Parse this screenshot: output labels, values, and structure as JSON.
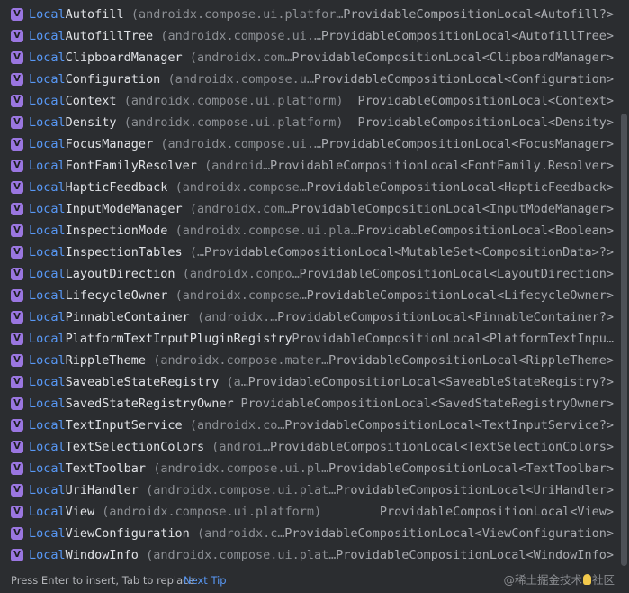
{
  "popup": {
    "items": [
      {
        "prefix": "Local",
        "rest": "Autofill",
        "pkg": "(androidx.compose.ui.platfor…",
        "type": "ProvidableCompositionLocal<Autofill?>"
      },
      {
        "prefix": "Local",
        "rest": "AutofillTree",
        "pkg": "(androidx.compose.ui.…",
        "type": "ProvidableCompositionLocal<AutofillTree>"
      },
      {
        "prefix": "Local",
        "rest": "ClipboardManager",
        "pkg": "(androidx.com…",
        "type": "ProvidableCompositionLocal<ClipboardManager>"
      },
      {
        "prefix": "Local",
        "rest": "Configuration",
        "pkg": "(androidx.compose.u…",
        "type": "ProvidableCompositionLocal<Configuration>"
      },
      {
        "prefix": "Local",
        "rest": "Context",
        "pkg": "(androidx.compose.ui.platform)",
        "type": "ProvidableCompositionLocal<Context>"
      },
      {
        "prefix": "Local",
        "rest": "Density",
        "pkg": "(androidx.compose.ui.platform)",
        "type": "ProvidableCompositionLocal<Density>"
      },
      {
        "prefix": "Local",
        "rest": "FocusManager",
        "pkg": "(androidx.compose.ui.…",
        "type": "ProvidableCompositionLocal<FocusManager>"
      },
      {
        "prefix": "Local",
        "rest": "FontFamilyResolver",
        "pkg": "(android…",
        "type": "ProvidableCompositionLocal<FontFamily.Resolver>"
      },
      {
        "prefix": "Local",
        "rest": "HapticFeedback",
        "pkg": "(androidx.compose…",
        "type": "ProvidableCompositionLocal<HapticFeedback>"
      },
      {
        "prefix": "Local",
        "rest": "InputModeManager",
        "pkg": "(androidx.com…",
        "type": "ProvidableCompositionLocal<InputModeManager>"
      },
      {
        "prefix": "Local",
        "rest": "InspectionMode",
        "pkg": "(androidx.compose.ui.pla…",
        "type": "ProvidableCompositionLocal<Boolean>"
      },
      {
        "prefix": "Local",
        "rest": "InspectionTables",
        "pkg": "(…",
        "type": "ProvidableCompositionLocal<MutableSet<CompositionData>?>"
      },
      {
        "prefix": "Local",
        "rest": "LayoutDirection",
        "pkg": "(androidx.compo…",
        "type": "ProvidableCompositionLocal<LayoutDirection>"
      },
      {
        "prefix": "Local",
        "rest": "LifecycleOwner",
        "pkg": "(androidx.compose…",
        "type": "ProvidableCompositionLocal<LifecycleOwner>"
      },
      {
        "prefix": "Local",
        "rest": "PinnableContainer",
        "pkg": "(androidx.…",
        "type": "ProvidableCompositionLocal<PinnableContainer?>"
      },
      {
        "prefix": "Local",
        "rest": "PlatformTextInputPluginRegistry",
        "pkg": "",
        "type": "ProvidableCompositionLocal<PlatformTextInpu…"
      },
      {
        "prefix": "Local",
        "rest": "RippleTheme",
        "pkg": "(androidx.compose.mater…",
        "type": "ProvidableCompositionLocal<RippleTheme>"
      },
      {
        "prefix": "Local",
        "rest": "SaveableStateRegistry",
        "pkg": "(a…",
        "type": "ProvidableCompositionLocal<SaveableStateRegistry?>"
      },
      {
        "prefix": "Local",
        "rest": "SavedStateRegistryOwner",
        "pkg": "",
        "type": "ProvidableCompositionLocal<SavedStateRegistryOwner>"
      },
      {
        "prefix": "Local",
        "rest": "TextInputService",
        "pkg": "(androidx.co…",
        "type": "ProvidableCompositionLocal<TextInputService?>"
      },
      {
        "prefix": "Local",
        "rest": "TextSelectionColors",
        "pkg": "(androi…",
        "type": "ProvidableCompositionLocal<TextSelectionColors>"
      },
      {
        "prefix": "Local",
        "rest": "TextToolbar",
        "pkg": "(androidx.compose.ui.pl…",
        "type": "ProvidableCompositionLocal<TextToolbar>"
      },
      {
        "prefix": "Local",
        "rest": "UriHandler",
        "pkg": "(androidx.compose.ui.plat…",
        "type": "ProvidableCompositionLocal<UriHandler>"
      },
      {
        "prefix": "Local",
        "rest": "View",
        "pkg": "(androidx.compose.ui.platform)",
        "type": "ProvidableCompositionLocal<View>"
      },
      {
        "prefix": "Local",
        "rest": "ViewConfiguration",
        "pkg": "(androidx.c…",
        "type": "ProvidableCompositionLocal<ViewConfiguration>"
      },
      {
        "prefix": "Local",
        "rest": "WindowInfo",
        "pkg": "(androidx.compose.ui.plat…",
        "type": "ProvidableCompositionLocal<WindowInfo>"
      }
    ],
    "item_icon": {
      "letter": "V",
      "name": "variable-icon",
      "color": "#9a76e0"
    },
    "colors": {
      "background": "#2b2d30",
      "match_highlight": "#5898f5",
      "name_text": "#dfe1e5",
      "package_text": "#8c8f94",
      "type_text": "#a9abb0"
    }
  },
  "footer": {
    "hint": "Press Enter to insert, Tab to replace",
    "next_tip": "Next Tip",
    "watermark_before": "@稀土掘金技术",
    "watermark_after": "社区"
  }
}
